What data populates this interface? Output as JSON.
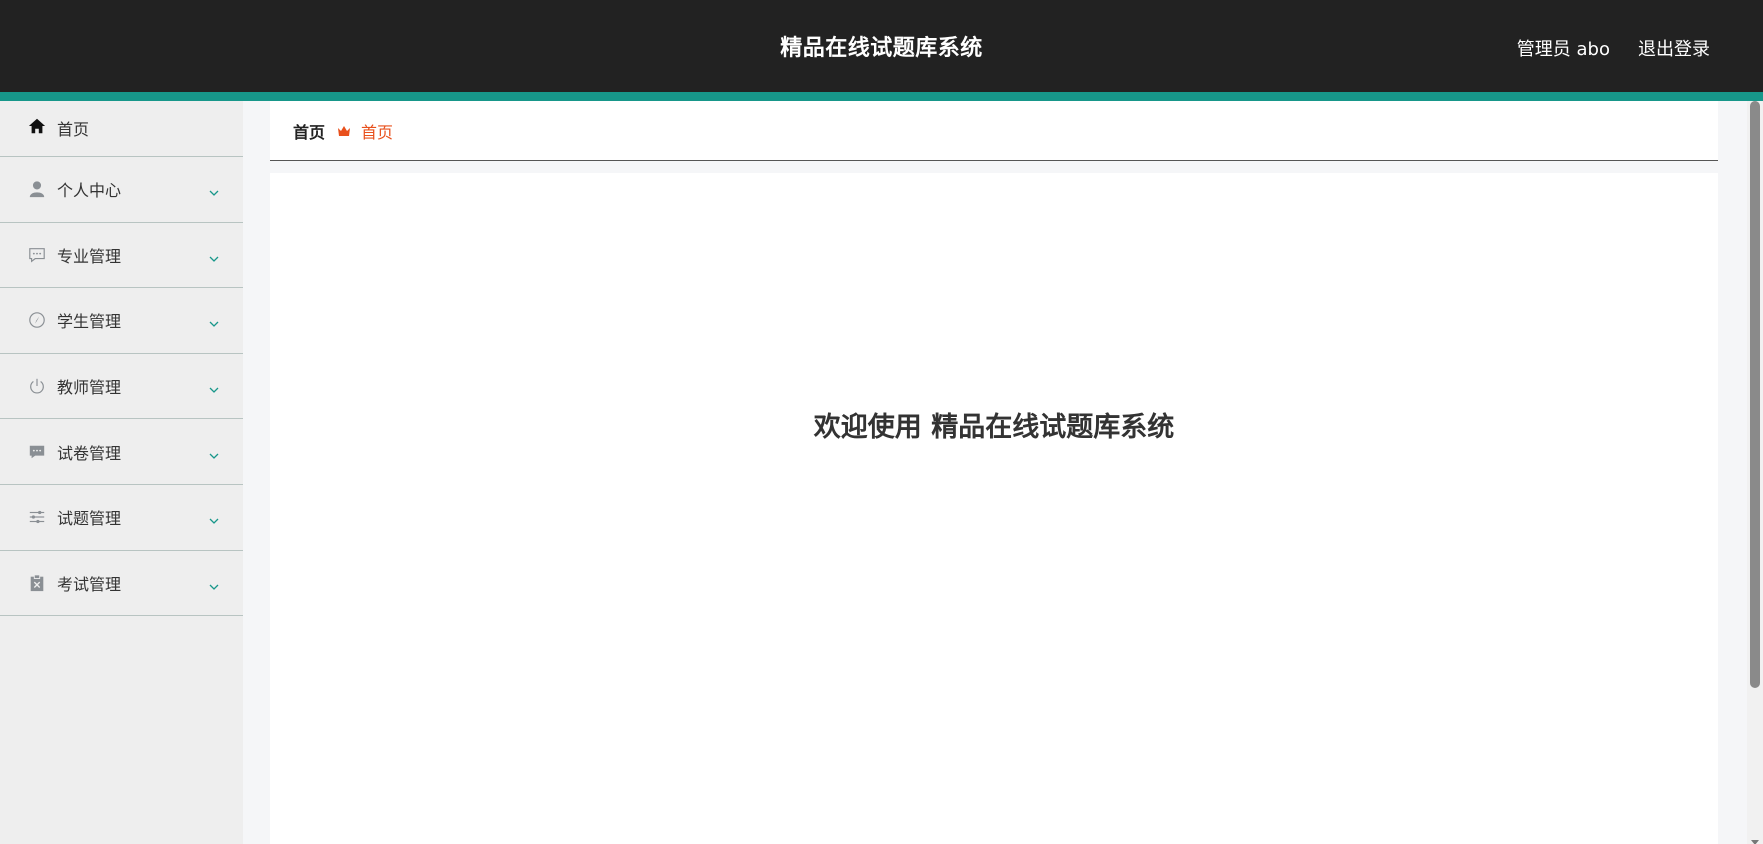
{
  "header": {
    "title": "精品在线试题库系统",
    "user_label": "管理员 abo",
    "logout_label": "退出登录"
  },
  "sidebar": {
    "items": [
      {
        "label": "首页",
        "icon": "home-icon"
      },
      {
        "label": "个人中心",
        "icon": "user-icon"
      },
      {
        "label": "专业管理",
        "icon": "chat-dots-icon"
      },
      {
        "label": "学生管理",
        "icon": "compass-icon"
      },
      {
        "label": "教师管理",
        "icon": "power-icon"
      },
      {
        "label": "试卷管理",
        "icon": "message-icon"
      },
      {
        "label": "试题管理",
        "icon": "sliders-icon"
      },
      {
        "label": "考试管理",
        "icon": "clipboard-x-icon"
      }
    ]
  },
  "breadcrumb": {
    "root": "首页",
    "current": "首页"
  },
  "main": {
    "welcome": "欢迎使用 精品在线试题库系统"
  },
  "colors": {
    "topbar": "#222222",
    "accent": "#17978a",
    "breadcrumb_active": "#e8501c",
    "sidebar_bg": "#eeeeee"
  }
}
